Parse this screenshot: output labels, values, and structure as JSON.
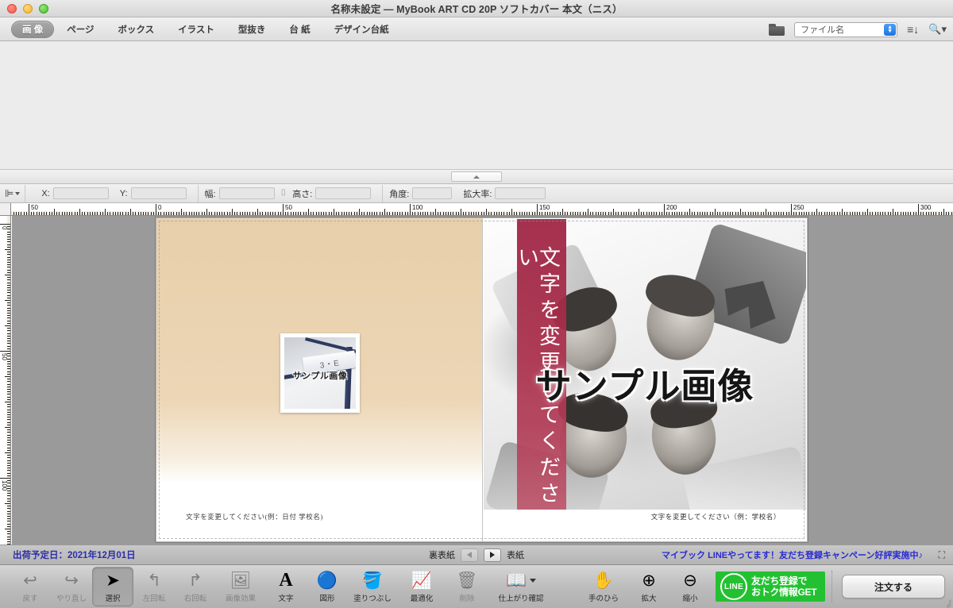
{
  "window": {
    "title": "名称未設定 — MyBook ART CD 20P ソフトカバー 本文（ニス）",
    "traffic_lights": [
      "close",
      "minimize",
      "zoom"
    ]
  },
  "tabbar": {
    "tabs": [
      {
        "label": "画 像",
        "active": true
      },
      {
        "label": "ページ",
        "active": false
      },
      {
        "label": "ボックス",
        "active": false
      },
      {
        "label": "イラスト",
        "active": false
      },
      {
        "label": "型抜き",
        "active": false
      },
      {
        "label": "台 紙",
        "active": false
      },
      {
        "label": "デザイン台紙",
        "active": false
      }
    ],
    "right": {
      "folder_icon": "folder-icon",
      "filter_value": "ファイル名",
      "sort_icon": "sort-icon",
      "search_icon": "search-icon"
    }
  },
  "propertybar": {
    "align_label": "整列",
    "fields": [
      {
        "label": "X:",
        "value": ""
      },
      {
        "label": "Y:",
        "value": ""
      },
      {
        "label": "幅:",
        "value": ""
      },
      {
        "label": "高さ:",
        "value": ""
      },
      {
        "label": "角度:",
        "value": ""
      },
      {
        "label": "拡大率:",
        "value": ""
      }
    ]
  },
  "rulers": {
    "horizontal_labels": [
      "50",
      "0",
      "50",
      "100",
      "150",
      "200",
      "250",
      "300"
    ],
    "vertical_labels": [
      "0",
      "50",
      "100"
    ],
    "unit": "mm"
  },
  "canvas": {
    "back_cover": {
      "caption": "文字を変更してください(例：日付 学校名)",
      "photo": {
        "sign_text": "3・E",
        "watermark": "サンプル画像"
      },
      "background_color": "#ecd6b5"
    },
    "front_cover": {
      "band_text": "文字を変更してください",
      "band_color": "#9d2140",
      "watermark": "サンプル画像",
      "caption": "文字を変更してください（例：学校名）"
    }
  },
  "statusbar": {
    "ship_date": "出荷予定日：2021年12月01日",
    "prev_page_label": "裏表紙",
    "next_page_label": "表紙",
    "promo": "マイブック LINEやってます！友だち登録キャンペーン好評実施中♪",
    "fullscreen_icon": "fullscreen-icon"
  },
  "bottom_toolbar": {
    "tools": [
      {
        "label": "戻す",
        "icon": "undo-icon",
        "state": "disabled"
      },
      {
        "label": "やり直し",
        "icon": "redo-icon",
        "state": "disabled"
      },
      {
        "label": "選択",
        "icon": "cursor-icon",
        "state": "selected"
      },
      {
        "label": "左回転",
        "icon": "rotate-left-icon",
        "state": "disabled"
      },
      {
        "label": "右回転",
        "icon": "rotate-right-icon",
        "state": "disabled"
      },
      {
        "label": "画像効果",
        "icon": "image-effect-icon",
        "state": "disabled"
      },
      {
        "label": "文字",
        "icon": "text-icon",
        "state": "enabled"
      },
      {
        "label": "図形",
        "icon": "shape-icon",
        "state": "enabled"
      },
      {
        "label": "塗りつぶし",
        "icon": "paint-bucket-icon",
        "state": "enabled"
      },
      {
        "label": "最適化",
        "icon": "optimize-icon",
        "state": "enabled"
      },
      {
        "label": "削除",
        "icon": "trash-icon",
        "state": "disabled"
      },
      {
        "label": "仕上がり確認",
        "icon": "book-preview-icon",
        "state": "enabled"
      },
      {
        "label": "手のひら",
        "icon": "hand-icon",
        "state": "enabled"
      },
      {
        "label": "拡大",
        "icon": "zoom-in-icon",
        "state": "enabled"
      },
      {
        "label": "縮小",
        "icon": "zoom-out-icon",
        "state": "enabled"
      }
    ],
    "line_banner": {
      "logo": "LINE",
      "line1": "友だち登録で",
      "line2": "おトク情報GET",
      "color": "#23c131"
    },
    "order_button": "注文する"
  }
}
